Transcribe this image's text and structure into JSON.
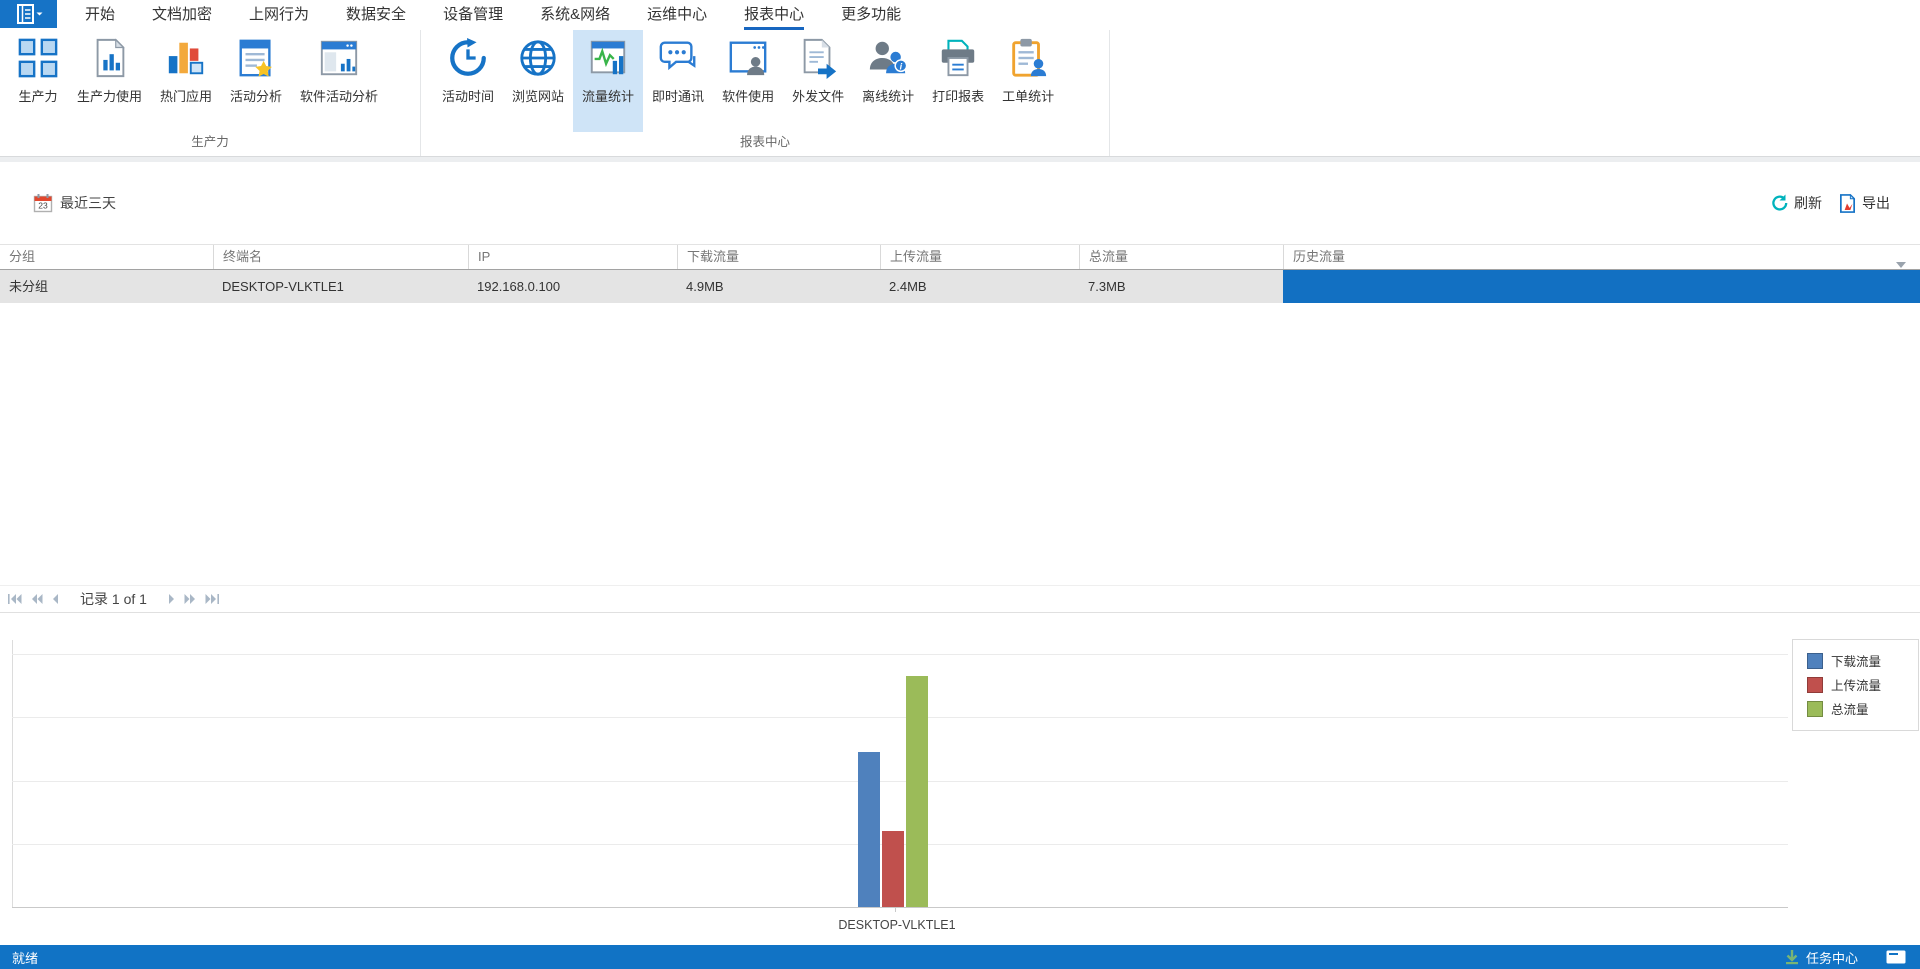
{
  "colors": {
    "accent_blue": "#1673c6",
    "ribbon_highlight": "#cfe4f7",
    "status_bar_blue": "#1173c5",
    "selected_row_gray": "#e4e4e4"
  },
  "menu": {
    "tabs": [
      {
        "label": "开始"
      },
      {
        "label": "文档加密"
      },
      {
        "label": "上网行为"
      },
      {
        "label": "数据安全"
      },
      {
        "label": "设备管理"
      },
      {
        "label": "系统&网络"
      },
      {
        "label": "运维中心"
      },
      {
        "label": "报表中心",
        "active": true
      },
      {
        "label": "更多功能"
      }
    ]
  },
  "ribbon": {
    "groups": [
      {
        "label": "生产力",
        "buttons": [
          {
            "label": "生产力",
            "icon": "productivity-grid-icon"
          },
          {
            "label": "生产力使用",
            "icon": "report-document-icon"
          },
          {
            "label": "热门应用",
            "icon": "bar-chart-icon"
          },
          {
            "label": "活动分析",
            "icon": "starred-report-icon"
          },
          {
            "label": "软件活动分析",
            "icon": "window-stats-icon"
          }
        ]
      },
      {
        "label": "报表中心",
        "buttons": [
          {
            "label": "活动时间",
            "icon": "history-clock-icon"
          },
          {
            "label": "浏览网站",
            "icon": "globe-icon"
          },
          {
            "label": "流量统计",
            "icon": "traffic-monitor-icon",
            "selected": true
          },
          {
            "label": "即时通讯",
            "icon": "chat-bubbles-icon"
          },
          {
            "label": "软件使用",
            "icon": "window-user-icon"
          },
          {
            "label": "外发文件",
            "icon": "outgoing-file-icon"
          },
          {
            "label": "离线统计",
            "icon": "offline-user-icon"
          },
          {
            "label": "打印报表",
            "icon": "printer-icon"
          },
          {
            "label": "工单统计",
            "icon": "work-order-icon"
          }
        ]
      }
    ]
  },
  "filter_bar": {
    "date_filter": {
      "label": "最近三天",
      "icon": "calendar-icon",
      "icon_day": "23"
    },
    "refresh_label": "刷新",
    "export_label": "导出"
  },
  "table": {
    "columns": [
      {
        "label": "分组"
      },
      {
        "label": "终端名"
      },
      {
        "label": "IP"
      },
      {
        "label": "下载流量"
      },
      {
        "label": "上传流量"
      },
      {
        "label": "总流量"
      },
      {
        "label": "历史流量"
      }
    ],
    "rows": [
      {
        "group": "未分组",
        "terminal": "DESKTOP-VLKTLE1",
        "ip": "192.168.0.100",
        "download": "4.9MB",
        "upload": "2.4MB",
        "total": "7.3MB",
        "history_bar": {
          "fill_ratio": 1,
          "color": "#1270c2"
        }
      }
    ]
  },
  "pagination": {
    "record_label": "记录 1 of 1"
  },
  "chart_data": {
    "type": "bar",
    "categories": [
      "DESKTOP-VLKTLE1"
    ],
    "series": [
      {
        "name": "下载流量",
        "values": [
          4.9
        ],
        "color": "#4f81bd"
      },
      {
        "name": "上传流量",
        "values": [
          2.4
        ],
        "color": "#c0504d"
      },
      {
        "name": "总流量",
        "values": [
          7.3
        ],
        "color": "#9bbb59"
      }
    ],
    "unit": "MB",
    "ylim": [
      0,
      8
    ],
    "gridline_interval": 2,
    "grid": true,
    "legend_position": "top-right",
    "axis_tick_labels_visible": false,
    "xlabel": "",
    "ylabel": "",
    "title": ""
  },
  "status_bar": {
    "ready_label": "就绪",
    "task_center_label": "任务中心"
  }
}
